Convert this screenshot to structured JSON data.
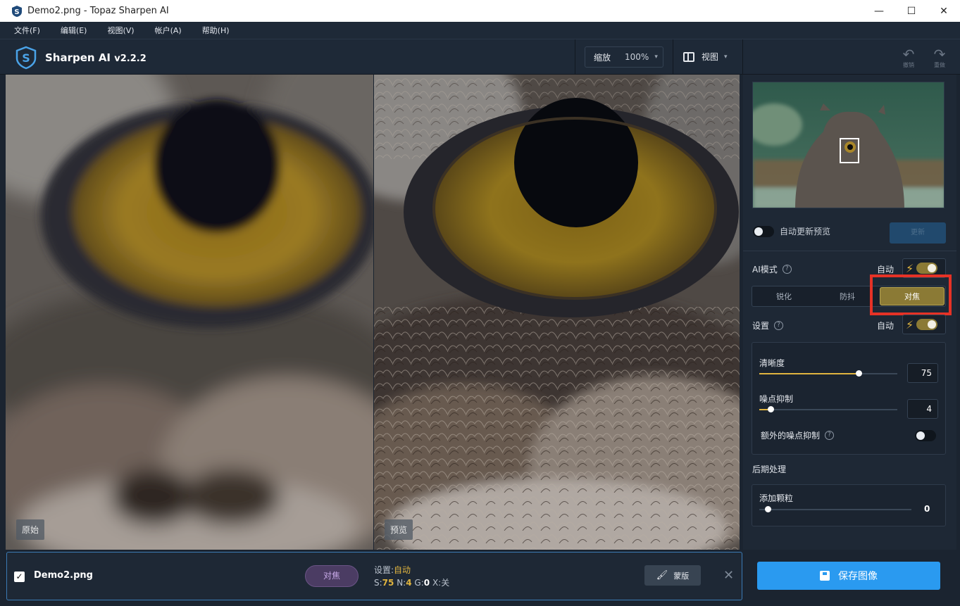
{
  "window": {
    "title": "Demo2.png - Topaz Sharpen AI",
    "minimize": "—",
    "maximize": "☐",
    "close": "✕"
  },
  "menu": [
    "文件(F)",
    "编辑(E)",
    "视图(V)",
    "帐户(A)",
    "帮助(H)"
  ],
  "toolbar": {
    "app_name": "Sharpen AI",
    "version": "v2.2.2",
    "zoom_label": "缩放",
    "zoom_value": "100%",
    "view_label": "视图",
    "undo_label": "撤销",
    "redo_label": "重做"
  },
  "panels": {
    "original_label": "原始",
    "preview_label": "预览"
  },
  "sidebar": {
    "auto_update_preview": "自动更新预览",
    "update_button": "更新",
    "ai_mode_label": "AI模式",
    "auto_label": "自动",
    "modes": [
      "锐化",
      "防抖",
      "对焦"
    ],
    "active_mode": "对焦",
    "settings_label": "设置",
    "sharpness_label": "清晰度",
    "sharpness_value": "75",
    "sharpness_level": 0.72,
    "noise_label": "噪点抑制",
    "noise_value": "4",
    "noise_level": 0.08,
    "extra_noise_label": "额外的噪点抑制",
    "post_label": "后期处理",
    "grain_label": "添加颗粒",
    "grain_value": "0",
    "save_button": "保存图像"
  },
  "filebar": {
    "filename": "Demo2.png",
    "mode_pill": "对焦",
    "settings_prefix": "设置:",
    "settings_auto": "自动",
    "s_label": "S:",
    "s_value": "75",
    "n_label": "N:",
    "n_value": "4",
    "g_label": "G:",
    "g_value": "0",
    "x_label": "X:",
    "x_value": "关",
    "mask_button": "蒙版"
  },
  "colors": {
    "accent_gold": "#e0b43f",
    "save_blue": "#2a9af0",
    "highlight_red": "#e63226"
  }
}
